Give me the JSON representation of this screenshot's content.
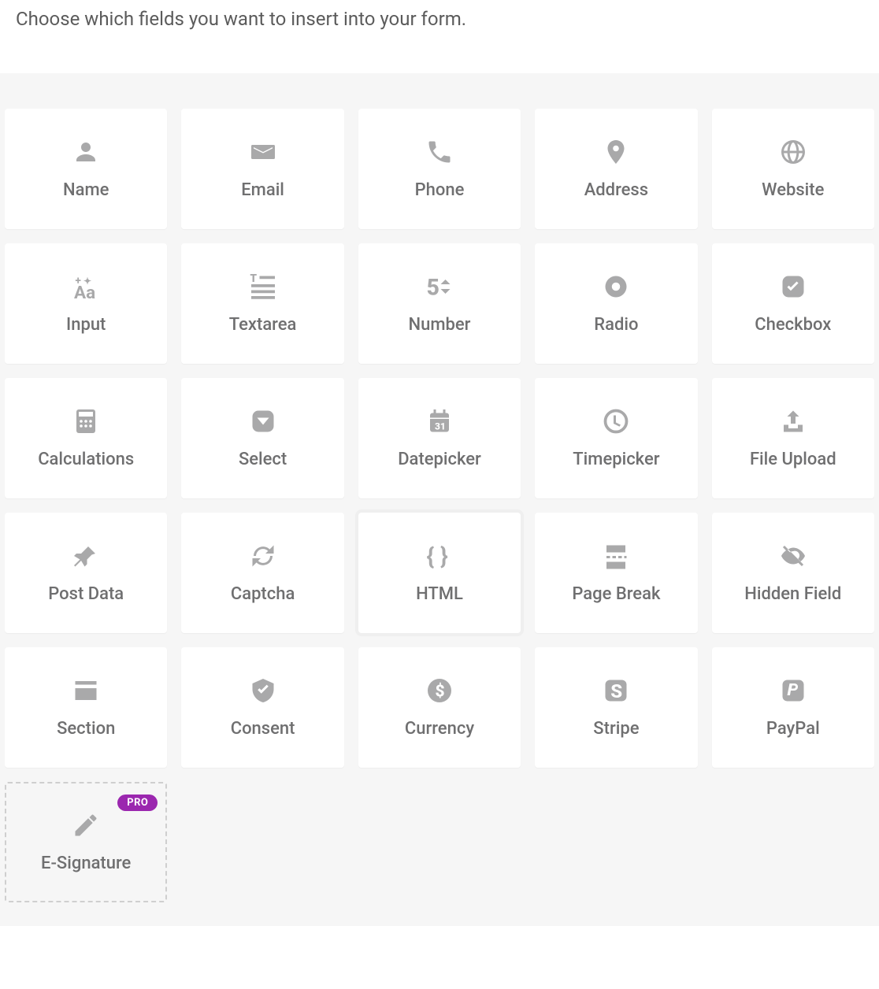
{
  "header": {
    "title": "Choose which fields you want to insert into your form."
  },
  "badge_pro": "PRO",
  "fields": [
    {
      "id": "name",
      "label": "Name",
      "icon": "user-icon"
    },
    {
      "id": "email",
      "label": "Email",
      "icon": "email-icon"
    },
    {
      "id": "phone",
      "label": "Phone",
      "icon": "phone-icon"
    },
    {
      "id": "address",
      "label": "Address",
      "icon": "location-icon"
    },
    {
      "id": "website",
      "label": "Website",
      "icon": "globe-icon"
    },
    {
      "id": "input",
      "label": "Input",
      "icon": "input-icon"
    },
    {
      "id": "textarea",
      "label": "Textarea",
      "icon": "textarea-icon"
    },
    {
      "id": "number",
      "label": "Number",
      "icon": "number-icon"
    },
    {
      "id": "radio",
      "label": "Radio",
      "icon": "radio-icon"
    },
    {
      "id": "checkbox",
      "label": "Checkbox",
      "icon": "checkbox-icon"
    },
    {
      "id": "calculations",
      "label": "Calculations",
      "icon": "calculator-icon"
    },
    {
      "id": "select",
      "label": "Select",
      "icon": "select-icon"
    },
    {
      "id": "datepicker",
      "label": "Datepicker",
      "icon": "calendar-icon"
    },
    {
      "id": "timepicker",
      "label": "Timepicker",
      "icon": "clock-icon"
    },
    {
      "id": "fileupload",
      "label": "File Upload",
      "icon": "upload-icon"
    },
    {
      "id": "postdata",
      "label": "Post Data",
      "icon": "pin-icon"
    },
    {
      "id": "captcha",
      "label": "Captcha",
      "icon": "refresh-icon"
    },
    {
      "id": "html",
      "label": "HTML",
      "icon": "braces-icon",
      "highlight": true
    },
    {
      "id": "pagebreak",
      "label": "Page Break",
      "icon": "pagebreak-icon"
    },
    {
      "id": "hidden",
      "label": "Hidden Field",
      "icon": "eye-off-icon"
    },
    {
      "id": "section",
      "label": "Section",
      "icon": "section-icon"
    },
    {
      "id": "consent",
      "label": "Consent",
      "icon": "shield-icon"
    },
    {
      "id": "currency",
      "label": "Currency",
      "icon": "dollar-icon"
    },
    {
      "id": "stripe",
      "label": "Stripe",
      "icon": "stripe-icon"
    },
    {
      "id": "paypal",
      "label": "PayPal",
      "icon": "paypal-icon"
    },
    {
      "id": "esignature",
      "label": "E-Signature",
      "icon": "pencil-icon",
      "pro": true
    }
  ]
}
